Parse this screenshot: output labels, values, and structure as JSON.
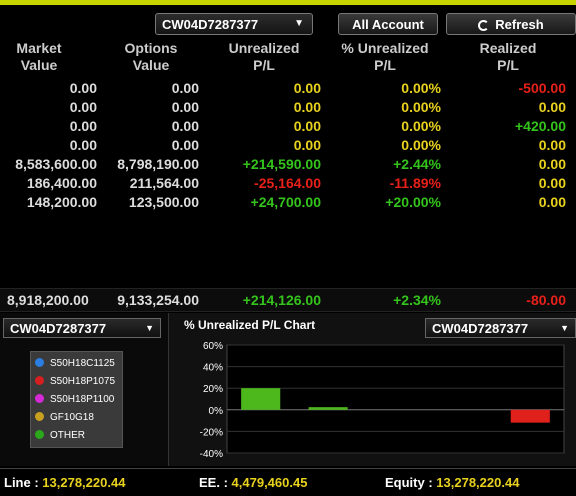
{
  "toolbar": {
    "account": "CW04D7287377",
    "all_account_label": "All Account",
    "refresh_label": "Refresh"
  },
  "headers": [
    [
      "Market",
      "Value"
    ],
    [
      "Options",
      "Value"
    ],
    [
      "Unrealized",
      "P/L"
    ],
    [
      "% Unrealized",
      "P/L"
    ],
    [
      "Realized",
      "P/L"
    ]
  ],
  "rows": [
    {
      "market": "0.00",
      "options": "0.00",
      "upl": "0.00",
      "pct": "0.00%",
      "rpl": "-500.00",
      "upl_c": "yellow",
      "pct_c": "yellow",
      "rpl_c": "red"
    },
    {
      "market": "0.00",
      "options": "0.00",
      "upl": "0.00",
      "pct": "0.00%",
      "rpl": "0.00",
      "upl_c": "yellow",
      "pct_c": "yellow",
      "rpl_c": "yellow"
    },
    {
      "market": "0.00",
      "options": "0.00",
      "upl": "0.00",
      "pct": "0.00%",
      "rpl": "+420.00",
      "upl_c": "yellow",
      "pct_c": "yellow",
      "rpl_c": "green"
    },
    {
      "market": "0.00",
      "options": "0.00",
      "upl": "0.00",
      "pct": "0.00%",
      "rpl": "0.00",
      "upl_c": "yellow",
      "pct_c": "yellow",
      "rpl_c": "yellow"
    },
    {
      "market": "8,583,600.00",
      "options": "8,798,190.00",
      "upl": "+214,590.00",
      "pct": "+2.44%",
      "rpl": "0.00",
      "upl_c": "green",
      "pct_c": "green",
      "rpl_c": "yellow"
    },
    {
      "market": "186,400.00",
      "options": "211,564.00",
      "upl": "-25,164.00",
      "pct": "-11.89%",
      "rpl": "0.00",
      "upl_c": "red",
      "pct_c": "red",
      "rpl_c": "yellow"
    },
    {
      "market": "148,200.00",
      "options": "123,500.00",
      "upl": "+24,700.00",
      "pct": "+20.00%",
      "rpl": "0.00",
      "upl_c": "green",
      "pct_c": "green",
      "rpl_c": "yellow"
    }
  ],
  "totals": {
    "market": "8,918,200.00",
    "options": "9,133,254.00",
    "upl": "+214,126.00",
    "pct": "+2.34%",
    "rpl": "-80.00",
    "upl_c": "green",
    "pct_c": "green",
    "rpl_c": "red"
  },
  "lower": {
    "left_account": "CW04D7287377",
    "right_account": "CW04D7287377",
    "chart_title": "% Unrealized P/L Chart",
    "legend": [
      {
        "label": "S50H18C1125",
        "color": "#2a7de1"
      },
      {
        "label": "S50H18P1075",
        "color": "#d62020"
      },
      {
        "label": "S50H18P1100",
        "color": "#d62ad6"
      },
      {
        "label": "GF10G18",
        "color": "#c8a020"
      },
      {
        "label": "OTHER",
        "color": "#2aa81a"
      }
    ]
  },
  "chart_data": {
    "type": "bar",
    "title": "% Unrealized P/L Chart",
    "categories": [
      "S50H18C1125",
      "S50H18P1075",
      "S50H18P1100",
      "GF10G18",
      "OTHER"
    ],
    "values": [
      20.0,
      2.44,
      0,
      0,
      -11.89
    ],
    "ylim": [
      -40,
      60
    ],
    "yticks": [
      "60%",
      "40%",
      "20%",
      "0%",
      "-20%",
      "-40%"
    ],
    "xlabel": "",
    "ylabel": "",
    "bar_colors": [
      "#4db81c",
      "#4db81c",
      "#4db81c",
      "#4db81c",
      "#e0201a"
    ],
    "grid": true
  },
  "footer": {
    "line_label": "Line :",
    "line_value": "13,278,220.44",
    "ee_label": "EE. :",
    "ee_value": "4,479,460.45",
    "equity_label": "Equity :",
    "equity_value": "13,278,220.44"
  }
}
